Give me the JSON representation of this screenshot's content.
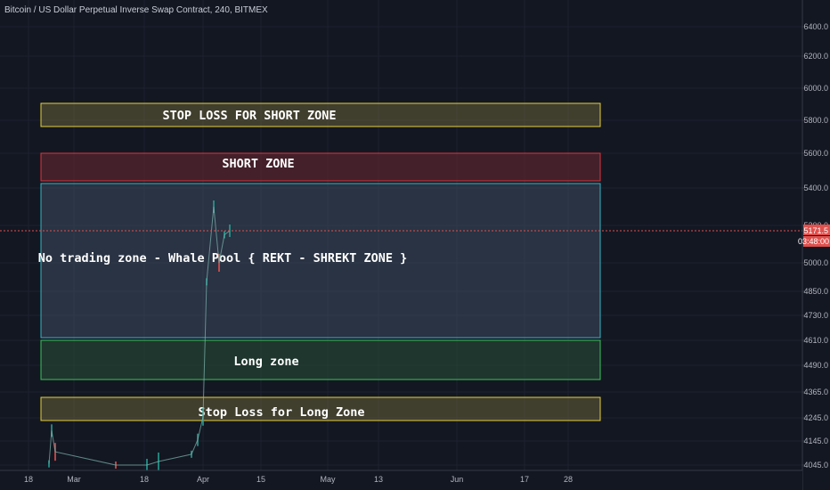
{
  "header": {
    "title": "Bitcoin / US Dollar Perpetual Inverse Swap Contract, 240, BITMEX"
  },
  "price_axis": {
    "ticks": [
      "6400.0",
      "6200.0",
      "6000.0",
      "5800.0",
      "5600.0",
      "5400.0",
      "5200.0",
      "5000.0",
      "4850.0",
      "4730.0",
      "4610.0",
      "4490.0",
      "4365.0",
      "4245.0",
      "4145.0",
      "4045.0"
    ],
    "last_price": "5171.5",
    "countdown": "03:48:00",
    "last_price_color": "#e0504d"
  },
  "time_axis": {
    "ticks": [
      "18",
      "Mar",
      "18",
      "Apr",
      "15",
      "May",
      "13",
      "Jun",
      "17",
      "28"
    ]
  },
  "zones": [
    {
      "id": "stop-loss-short",
      "label": "STOP LOSS FOR SHORT ZONE",
      "border": "#e6cf3e",
      "fill": "rgba(120,110,60,0.45)"
    },
    {
      "id": "short",
      "label": "SHORT ZONE",
      "border": "#d9363e",
      "fill": "rgba(110,40,50,0.55)"
    },
    {
      "id": "no-trade",
      "label": "No trading zone - Whale Pool { REKT - SHREKT ZONE }",
      "border": "#3bb3c3",
      "fill": "rgba(60,75,95,0.55)"
    },
    {
      "id": "long",
      "label": "Long zone",
      "border": "#3ec15c",
      "fill": "rgba(40,80,55,0.55)"
    },
    {
      "id": "stop-loss-long",
      "label": "Stop Loss for Long Zone",
      "border": "#e6cf3e",
      "fill": "rgba(120,110,60,0.45)"
    }
  ],
  "chart_data": {
    "type": "line",
    "title": "Bitcoin / US Dollar Perpetual Inverse Swap Contract, 240, BITMEX",
    "xlabel": "",
    "ylabel": "",
    "ylim": [
      4045,
      6400
    ],
    "x": [
      "Feb 22",
      "Feb 23",
      "Feb 24",
      "Mar 10",
      "Mar 18",
      "Mar 20",
      "Mar 30",
      "Apr 1",
      "Apr 2",
      "Apr 3",
      "Apr 4",
      "Apr 5",
      "Apr 6",
      "Apr 7"
    ],
    "series": [
      {
        "values": [
          4050,
          4190,
          4100,
          4010,
          4030,
          4060,
          4090,
          4150,
          4250,
          4900,
          5300,
          5000,
          5150,
          5171.5
        ]
      }
    ],
    "last_value": 5171.5,
    "grid": true
  }
}
